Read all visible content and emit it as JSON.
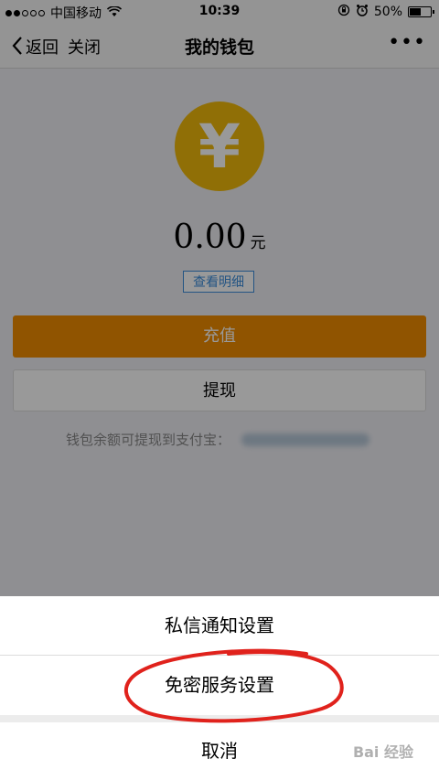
{
  "status_bar": {
    "carrier": "中国移动",
    "time": "10:39",
    "battery": "50%",
    "battery_level": 0.5
  },
  "nav": {
    "back_label": "返回",
    "close_label": "关闭",
    "title": "我的钱包",
    "more_label": "•••"
  },
  "wallet": {
    "currency_symbol": "¥",
    "amount": "0.00",
    "unit": "元",
    "detail_label": "查看明细",
    "recharge_label": "充值",
    "withdraw_label": "提现",
    "notice_text": "钱包余额可提现到支付宝："
  },
  "action_sheet": {
    "items": [
      "私信通知设置",
      "免密服务设置"
    ],
    "cancel_label": "取消"
  },
  "watermark": "Bai 经验",
  "colors": {
    "accent_orange": "#f08c00",
    "coin_yellow": "#f0b90b",
    "link_blue": "#3b8ddb",
    "annotation_red": "#e0221c"
  }
}
